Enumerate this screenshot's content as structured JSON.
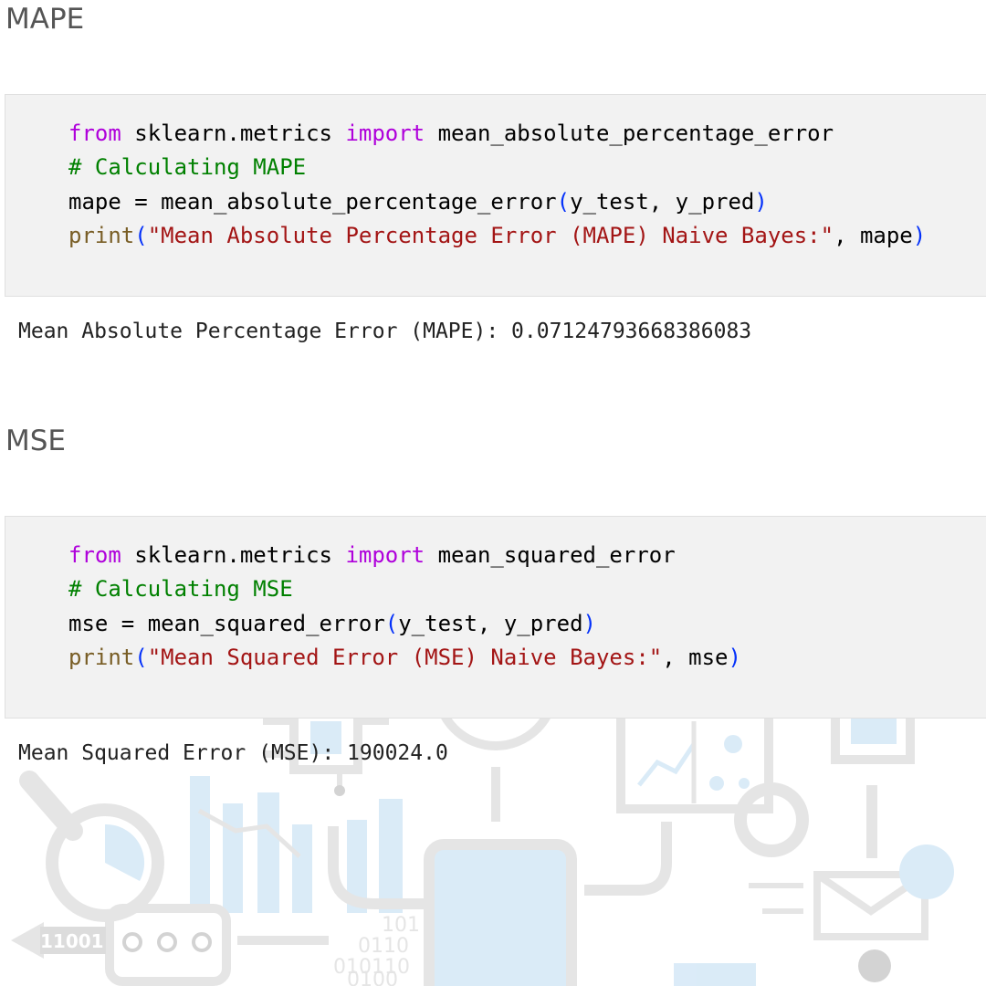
{
  "sections": [
    {
      "heading": "MAPE",
      "code": {
        "line1": {
          "kw1": "from",
          "mod": " sklearn.metrics ",
          "kw2": "import",
          "name": " mean_absolute_percentage_error"
        },
        "line2": {
          "comment": "# Calculating MAPE"
        },
        "line3": {
          "lhs": "mape = mean_absolute_percentage_error",
          "open": "(",
          "args": "y_test, y_pred",
          "close": ")"
        },
        "line4": {
          "fn": "print",
          "open": "(",
          "str": "\"Mean Absolute Percentage Error (MAPE) Naive Bayes:\"",
          "rest": ", mape",
          "close": ")"
        }
      },
      "output": "Mean Absolute Percentage Error (MAPE): 0.07124793668386083"
    },
    {
      "heading": "MSE",
      "code": {
        "line1": {
          "kw1": "from",
          "mod": " sklearn.metrics ",
          "kw2": "import",
          "name": " mean_squared_error"
        },
        "line2": {
          "comment": "# Calculating MSE"
        },
        "line3": {
          "lhs": "mse = mean_squared_error",
          "open": "(",
          "args": "y_test, y_pred",
          "close": ")"
        },
        "line4": {
          "fn": "print",
          "open": "(",
          "str": "\"Mean Squared Error (MSE) Naive Bayes:\"",
          "rest": ", mse",
          "close": ")"
        }
      },
      "output": "Mean Squared Error (MSE): 190024.0"
    }
  ],
  "background_art": {
    "binary_left": "11001",
    "binary_lines": [
      "101",
      "0110",
      "010110",
      "0100"
    ],
    "colors": {
      "gray": "#e3e3e3",
      "blue": "#d7e9f7",
      "darkgray": "#cfcfcf"
    }
  },
  "syntax_colors": {
    "keyword": "#af00db",
    "comment": "#008000",
    "builtin": "#795e26",
    "string": "#a31515",
    "paren": "#0431fa"
  }
}
